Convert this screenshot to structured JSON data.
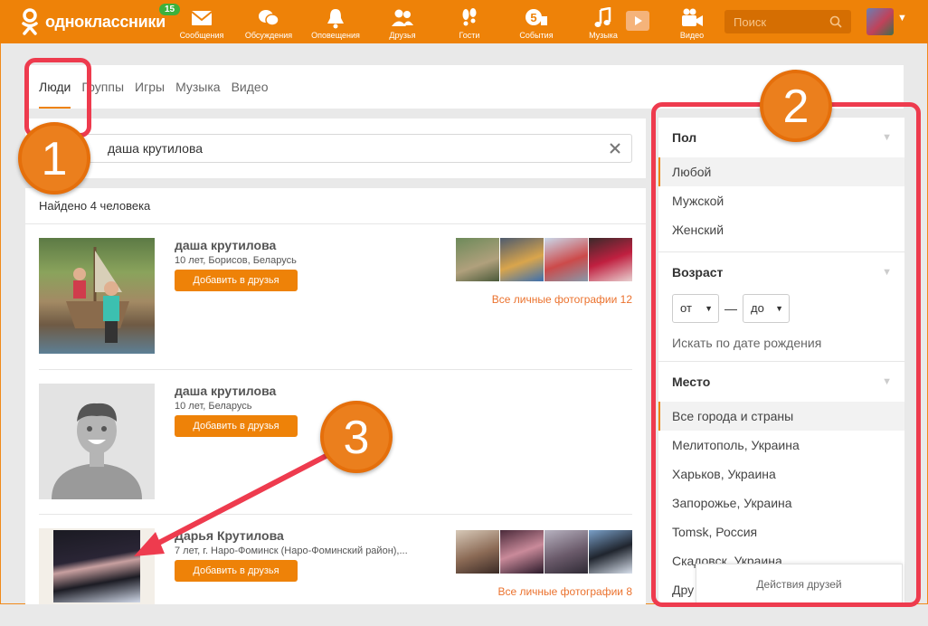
{
  "brand": {
    "name": "одноклассники",
    "badge": "15",
    "accent": "#ee8208"
  },
  "nav": [
    {
      "label": "Сообщения",
      "icon": "envelope-icon"
    },
    {
      "label": "Обсуждения",
      "icon": "chat-bubbles-icon"
    },
    {
      "label": "Оповещения",
      "icon": "bell-icon"
    },
    {
      "label": "Друзья",
      "icon": "friends-icon"
    },
    {
      "label": "Гости",
      "icon": "footprints-icon"
    },
    {
      "label": "События",
      "icon": "events-icon"
    },
    {
      "label": "Музыка",
      "icon": "music-note-icon"
    },
    {
      "label": "Видео",
      "icon": "video-camera-icon"
    }
  ],
  "search": {
    "placeholder": "Поиск"
  },
  "tabs": [
    {
      "label": "Люди"
    },
    {
      "label": "Группы"
    },
    {
      "label": "Игры"
    },
    {
      "label": "Музыка"
    },
    {
      "label": "Видео"
    }
  ],
  "query": {
    "value": "даша крутилова"
  },
  "results": {
    "found_text": "Найдено 4 человека",
    "people": [
      {
        "name": "даша крутилова",
        "info": "10 лет, Борисов, Беларусь",
        "button": "Добавить в друзья",
        "all_photos": "Все личные фотографии 12"
      },
      {
        "name": "даша крутилова",
        "info": "10 лет, Беларусь",
        "button": "Добавить в друзья"
      },
      {
        "name": "Дарья Крутилова",
        "info": "7 лет, г. Наро-Фоминск (Наро-Фоминский район),...",
        "button": "Добавить в друзья",
        "all_photos": "Все личные фотографии 8"
      }
    ]
  },
  "filters": {
    "gender": {
      "title": "Пол",
      "options": [
        "Любой",
        "Мужской",
        "Женский"
      ],
      "selected": "Любой"
    },
    "age": {
      "title": "Возраст",
      "from": "от",
      "dash": "—",
      "to": "до",
      "birth_link": "Искать по дате рождения"
    },
    "place": {
      "title": "Место",
      "options": [
        "Все города и страны",
        "Мелитополь, Украина",
        "Харьков, Украина",
        "Запорожье, Украина",
        "Tomsk, Россия",
        "Скадовск, Украина",
        "Дру"
      ],
      "selected": "Все города и страны"
    }
  },
  "friends_popup": "Действия друзей",
  "annotations": {
    "step1": "1",
    "step2": "2",
    "step3": "3",
    "color": "#ee3b4e"
  }
}
